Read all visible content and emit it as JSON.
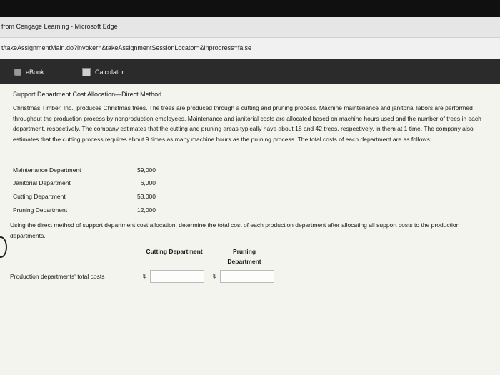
{
  "window": {
    "title": "from Cengage Learning - Microsoft Edge"
  },
  "address_bar": {
    "url": "t/takeAssignmentMain.do?invoker=&takeAssignmentSessionLocator=&inprogress=false"
  },
  "toolbar": {
    "ebook_label": "eBook",
    "calculator_label": "Calculator"
  },
  "problem": {
    "title": "Support Department Cost Allocation—Direct Method",
    "paragraph": "Christmas Timber, Inc., produces Christmas trees. The trees are produced through a cutting and pruning process. Machine maintenance and janitorial labors are performed throughout the production process by nonproduction employees. Maintenance and janitorial costs are allocated based on machine hours used and the number of trees in each department, respectively. The company estimates that the cutting and pruning areas typically have about 18 and 42 trees, respectively, in them at 1 time. The company also estimates that the cutting process requires about 9 times as many machine hours as the pruning process. The total costs of each department are as follows:",
    "departments": [
      {
        "name": "Maintenance Department",
        "cost": "$9,000"
      },
      {
        "name": "Janitorial Department",
        "cost": "6,000"
      },
      {
        "name": "Cutting Department",
        "cost": "53,000"
      },
      {
        "name": "Pruning Department",
        "cost": "12,000"
      }
    ],
    "question": "Using the direct method of support department cost allocation, determine the total cost of each production department after allocating all support costs to the production departments."
  },
  "answer_table": {
    "col_cutting": "Cutting Department",
    "col_pruning": "Pruning Department",
    "row_label": "Production departments' total costs",
    "currency": "$",
    "cutting_value": "",
    "pruning_value": ""
  }
}
